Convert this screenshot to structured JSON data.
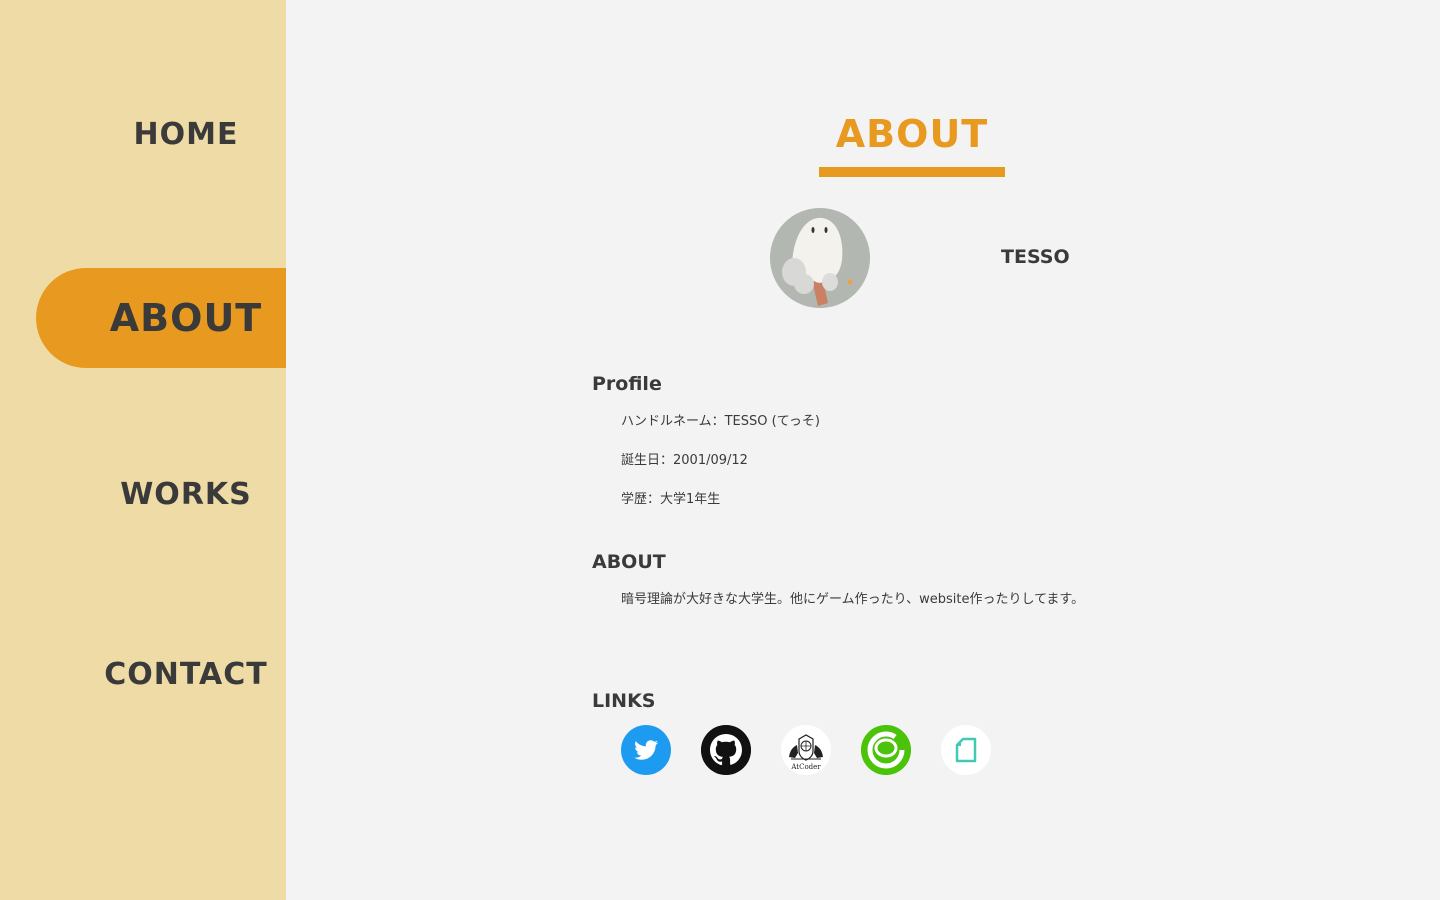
{
  "nav": {
    "home": "HOME",
    "about": "ABOUT",
    "works": "WORKS",
    "contact": "CONTACT"
  },
  "page": {
    "title": "ABOUT",
    "handle": "TESSO"
  },
  "sections": {
    "profile": {
      "heading": "Profile",
      "lines": [
        "ハンドルネーム：TESSO (てっそ)",
        "誕生日：2001/09/12",
        "学歴：大学1年生"
      ]
    },
    "about": {
      "heading": "ABOUT",
      "text": "暗号理論が大好きな大学生。他にゲーム作ったり、website作ったりしてます。"
    },
    "links": {
      "heading": "LINKS",
      "items": [
        {
          "icon": "twitter-icon",
          "color": "#1d9bf0"
        },
        {
          "icon": "github-icon",
          "color": "#111111"
        },
        {
          "icon": "atcoder-icon",
          "label": "AtCoder",
          "color": "#ffffff"
        },
        {
          "icon": "chat-app-icon",
          "color": "#4bc30a"
        },
        {
          "icon": "note-icon",
          "color": "#41c9b4"
        }
      ]
    }
  },
  "colors": {
    "sidebar": "#eedba6",
    "accent": "#e8991f",
    "background": "#f3f3f3",
    "text": "#3a3a3a"
  }
}
